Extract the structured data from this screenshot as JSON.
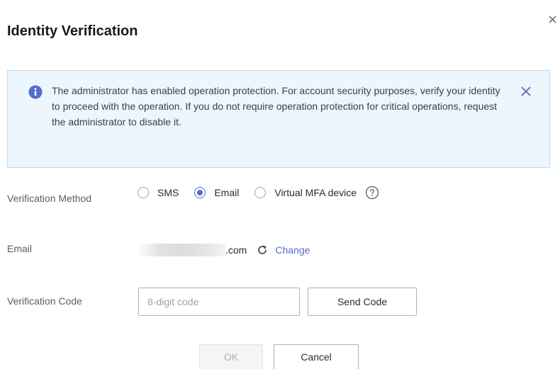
{
  "dialog": {
    "title": "Identity Verification"
  },
  "alert": {
    "text": "The administrator has enabled operation protection. For account security purposes, verify your identity to proceed with the operation. If you do not require operation protection for critical operations, request the administrator to disable it.",
    "color": "#edf5fd",
    "icon": "info-circle-icon"
  },
  "verification_method": {
    "label": "Verification Method",
    "options": [
      {
        "label": "SMS",
        "checked": false
      },
      {
        "label": "Email",
        "checked": true
      },
      {
        "label": "Virtual MFA device",
        "checked": false
      }
    ]
  },
  "email": {
    "label": "Email",
    "value_suffix": ".com",
    "change_label": "Change"
  },
  "verification_code": {
    "label": "Verification Code",
    "placeholder": "8-digit code",
    "value": "",
    "send_label": "Send Code"
  },
  "footer": {
    "ok_label": "OK",
    "cancel_label": "Cancel"
  },
  "colors": {
    "accent": "#526ecc",
    "info": "#526ecc"
  }
}
